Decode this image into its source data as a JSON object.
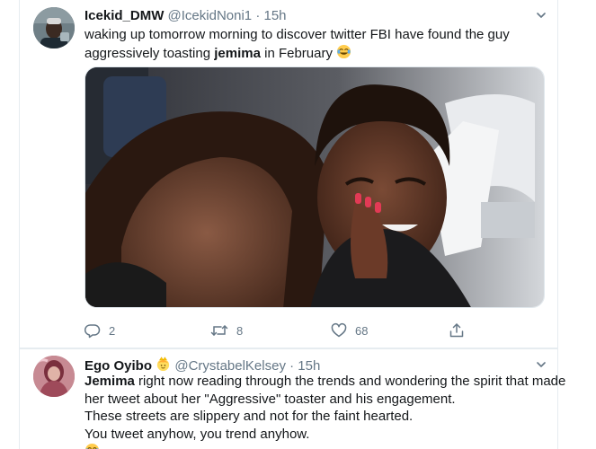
{
  "tweets": [
    {
      "display_name": "Icekid_DMW",
      "handle": "@IcekidNoni1",
      "separator": "·",
      "time": "15h",
      "text_line1": "waking up tomorrow morning to discover twitter FBI have found the guy",
      "text_line2_pre": "aggressively toasting ",
      "text_line2_bold": "jemima",
      "text_line2_post": " in February ",
      "text_emoji": "joy-emoji",
      "counts": {
        "replies": "2",
        "retweets": "8",
        "likes": "68"
      },
      "icons": [
        "reply-icon",
        "retweet-icon",
        "like-icon",
        "share-icon",
        "caret-down-icon"
      ]
    },
    {
      "display_name": "Ego Oyibo",
      "name_emoji": "princess-emoji",
      "handle": "@CrystabelKelsey",
      "separator": "·",
      "time": "15h",
      "line1_bold": "Jemima",
      "line1_rest": " right now reading through the trends and wondering the spirit that made",
      "line2": "her tweet about her \"Aggressive\" toaster and his engagement.",
      "line3": "These streets are slippery and not for the faint hearted.",
      "line4": "You tweet anyhow, you trend anyhow.",
      "line5_emoji": "joy-emoji"
    }
  ],
  "colors": {
    "text": "#14171a",
    "secondary": "#657786",
    "border": "#e6ecf0"
  }
}
